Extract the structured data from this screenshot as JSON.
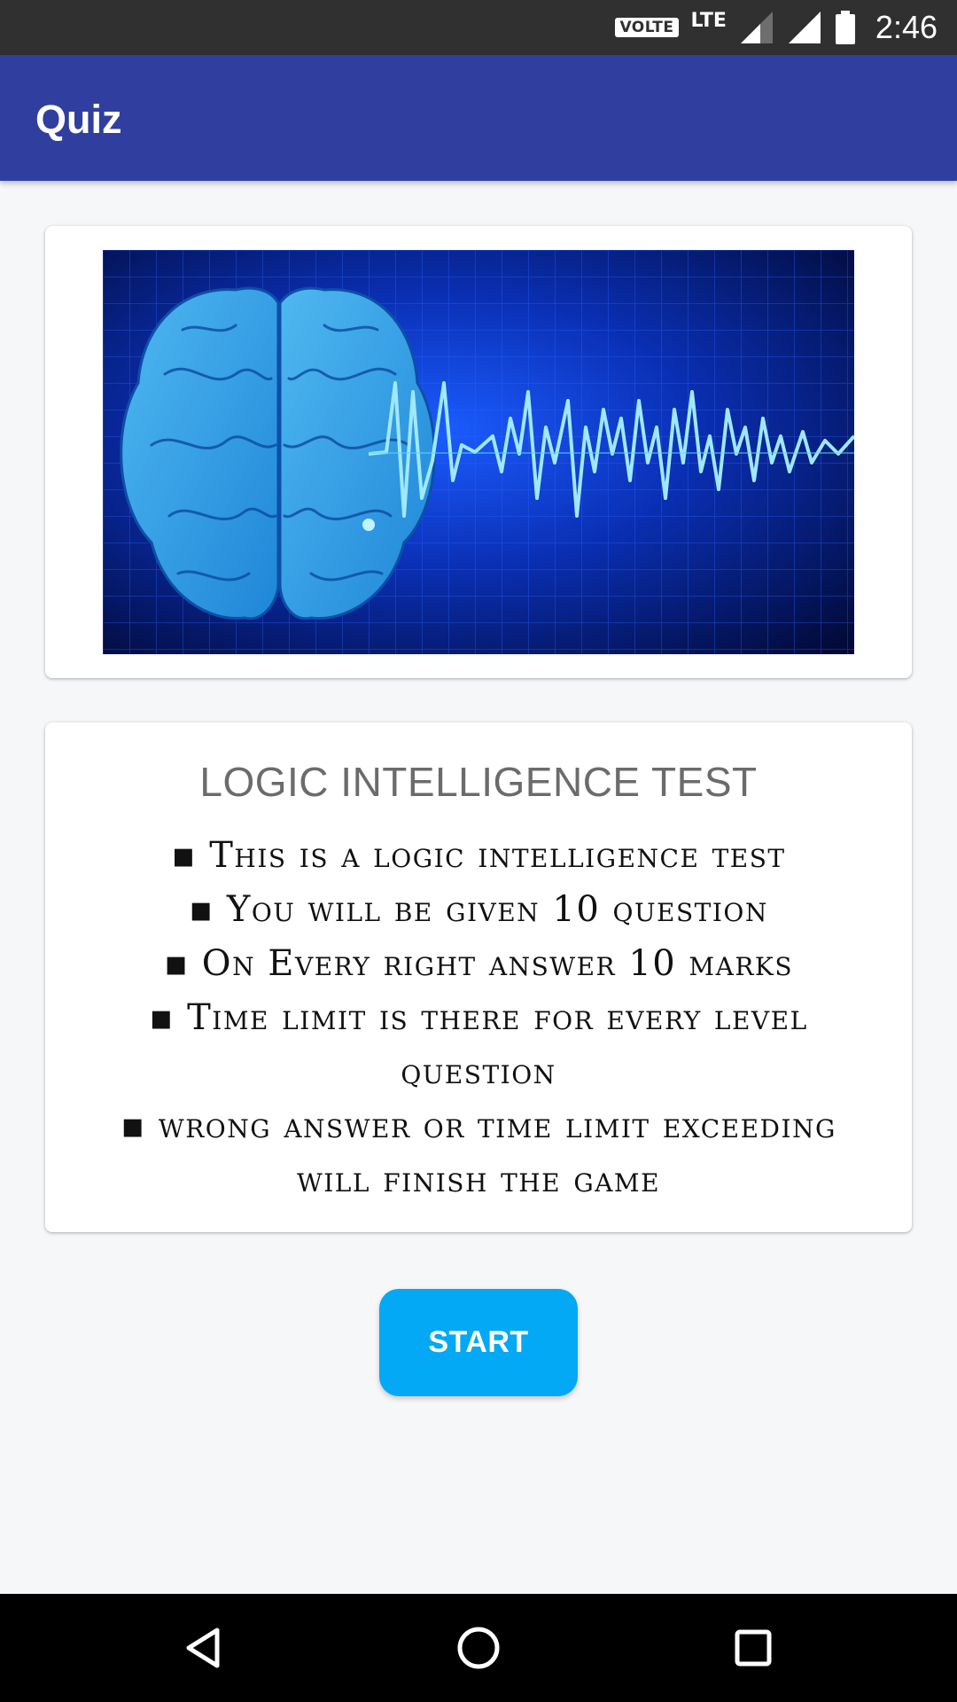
{
  "status_bar": {
    "volte": "VOLTE",
    "network": "LTE",
    "time": "2:46"
  },
  "app_bar": {
    "title": "Quiz"
  },
  "hero": {
    "icon": "brain-wave-image"
  },
  "info": {
    "title": "LOGIC INTELLIGENCE TEST",
    "rules": [
      "▪ This is a logic intelligence test",
      "▪ You will be given 10 question",
      "▪ On Every right answer 10 marks",
      "▪ Time limit is there for every level question",
      "▪ wrong answer or time limit exceeding will finish the game"
    ]
  },
  "start_button": {
    "label": "START"
  },
  "colors": {
    "status_bar": "#303030",
    "app_bar": "#303f9f",
    "accent": "#03a9f4",
    "background": "#f6f7f8"
  },
  "nav": {
    "back_icon": "back-triangle-icon",
    "home_icon": "home-circle-icon",
    "recents_icon": "recents-square-icon"
  }
}
